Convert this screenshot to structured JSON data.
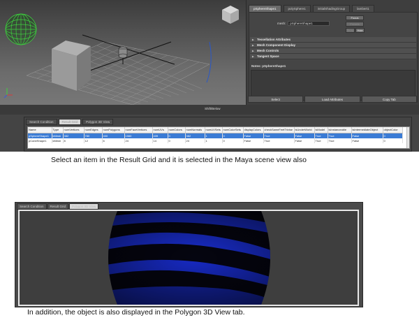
{
  "attribute_editor": {
    "tabs": [
      "pSphereShape1",
      "polySphere1",
      "initialShadingGroup",
      "lambert1"
    ],
    "mesh_label": "mesh:",
    "mesh_value": "pSphereShape1",
    "buttons": {
      "focus": "Focus",
      "presets": "Presets",
      "show": "Show",
      "hide": "Hide"
    },
    "sections": [
      "Tessellation Attributes",
      "Mesh Component Display",
      "Mesh Controls",
      "Tangent Space"
    ],
    "notes_label": "Notes: pSphereShape1",
    "bottom_buttons": [
      "Select",
      "Load Attributes",
      "Copy Tab"
    ]
  },
  "shelf": {
    "label": "Shift/Below"
  },
  "result_grid": {
    "tabs": [
      "Search Condition",
      "Result Grid",
      "Polygon 3D View"
    ],
    "active_tab": "Result Grid",
    "columns": [
      "Name",
      "Type",
      "numVertices",
      "numEdges",
      "numPolygons",
      "numFaceVertices",
      "numUVs",
      "numColors",
      "numNormals",
      "numUVSets",
      "numColorSets",
      "displayColors",
      "checkSameFeetTrivise",
      "isUnderWorld",
      "isModel",
      "isInstanceable",
      "isIntermediateObject",
      "objectColor"
    ],
    "rows": [
      [
        "pSphereShape1",
        "kMesh",
        "382",
        "780",
        "400",
        "1560",
        "439",
        "0",
        "382",
        "1",
        "0",
        "False",
        "True",
        "False",
        "True",
        "True",
        "False",
        "0"
      ],
      [
        "pCubeShape1",
        "kMesh",
        "8",
        "12",
        "6",
        "24",
        "14",
        "0",
        "24",
        "1",
        "0",
        "False",
        "True",
        "False",
        "True",
        "True",
        "False",
        "0"
      ]
    ]
  },
  "captions": {
    "first": "Select an item in the Result Grid and it is selected in the Maya scene view also",
    "second": "In addition, the object is also displayed in the Polygon 3D View tab."
  },
  "polygon_view": {
    "tabs": [
      "Search Condition",
      "Result Grid",
      "Polygon 3D View"
    ],
    "active_tab": "Polygon 3D View"
  },
  "colors": {
    "selection_blue": "#3a7bd5",
    "sphere_blue": "#1a2fd8",
    "sphere_dark": "#050510",
    "wireframe_green": "#3fd13f"
  }
}
